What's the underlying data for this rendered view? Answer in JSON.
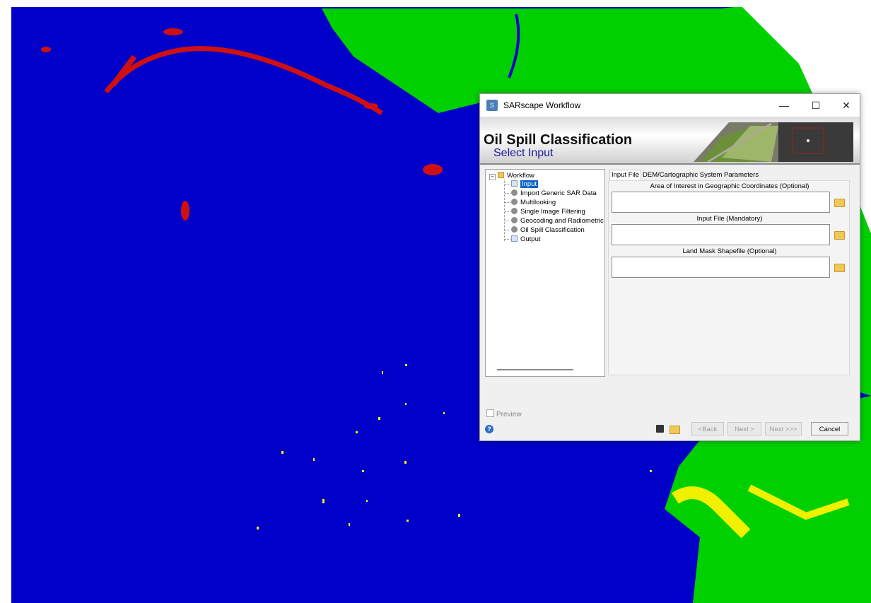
{
  "window": {
    "title": "SARscape Workflow",
    "controls": {
      "minimize": "—",
      "maximize": "☐",
      "close": "✕"
    }
  },
  "banner": {
    "heading": "Oil Spill Classification",
    "subheading": "Select Input"
  },
  "tree": {
    "root": "Workflow",
    "items": [
      {
        "label": "Input",
        "icon": "page-icon",
        "selected": true
      },
      {
        "label": "Import Generic SAR Data",
        "icon": "gear-icon"
      },
      {
        "label": "Multilooking",
        "icon": "gear-icon"
      },
      {
        "label": "Single Image Filtering",
        "icon": "gear-icon"
      },
      {
        "label": "Geocoding and Radiometric",
        "icon": "gear-icon"
      },
      {
        "label": "Oil Spill Classification",
        "icon": "gear-icon"
      },
      {
        "label": "Output",
        "icon": "page-icon"
      }
    ]
  },
  "tabs": [
    {
      "label": "Input File",
      "active": true
    },
    {
      "label": "DEM/Cartographic System"
    },
    {
      "label": "Parameters"
    }
  ],
  "fields": [
    {
      "label": "Area of Interest in Geographic Coordinates (Optional)",
      "value": ""
    },
    {
      "label": "Input File (Mandatory)",
      "value": ""
    },
    {
      "label": "Land Mask Shapefile (Optional)",
      "value": ""
    }
  ],
  "footer": {
    "preview": "Preview",
    "help": "?",
    "back": "<Back",
    "next": "Next >",
    "next_all": "Next >>>",
    "cancel": "Cancel"
  },
  "map_colors": {
    "water": "#0000c8",
    "land": "#00d000",
    "oil": "#d01010",
    "bright": "#f0f000"
  }
}
